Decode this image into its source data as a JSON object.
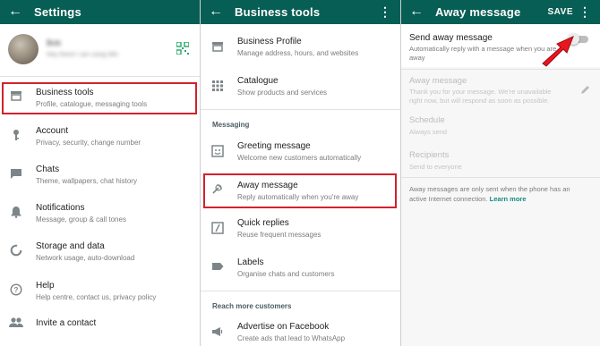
{
  "panel1": {
    "appbar": {
      "title": "Settings"
    },
    "profile": {
      "name": "Bob",
      "status": "Hey there! I am using WhatsApp."
    },
    "items": [
      {
        "title": "Business tools",
        "subtitle": "Profile, catalogue, messaging tools",
        "icon": "store-icon"
      },
      {
        "title": "Account",
        "subtitle": "Privacy, security, change number",
        "icon": "key-icon"
      },
      {
        "title": "Chats",
        "subtitle": "Theme, wallpapers, chat history",
        "icon": "chat-icon"
      },
      {
        "title": "Notifications",
        "subtitle": "Message, group & call tones",
        "icon": "bell-icon"
      },
      {
        "title": "Storage and data",
        "subtitle": "Network usage, auto-download",
        "icon": "data-usage-icon"
      },
      {
        "title": "Help",
        "subtitle": "Help centre, contact us, privacy policy",
        "icon": "help-icon"
      },
      {
        "title": "Invite a contact",
        "subtitle": "",
        "icon": "people-icon"
      }
    ]
  },
  "panel2": {
    "appbar": {
      "title": "Business tools"
    },
    "top_items": [
      {
        "title": "Business Profile",
        "subtitle": "Manage address, hours, and websites",
        "icon": "store-icon"
      },
      {
        "title": "Catalogue",
        "subtitle": "Show products and services",
        "icon": "grid-icon"
      }
    ],
    "messaging_header": "Messaging",
    "messaging_items": [
      {
        "title": "Greeting message",
        "subtitle": "Welcome new customers automatically",
        "icon": "greeting-icon"
      },
      {
        "title": "Away message",
        "subtitle": "Reply automatically when you're away",
        "icon": "away-icon"
      },
      {
        "title": "Quick replies",
        "subtitle": "Reuse frequent messages",
        "icon": "quick-reply-icon"
      },
      {
        "title": "Labels",
        "subtitle": "Organise chats and customers",
        "icon": "label-icon"
      }
    ],
    "reach_header": "Reach more customers",
    "reach_items": [
      {
        "title": "Advertise on Facebook",
        "subtitle": "Create ads that lead to WhatsApp",
        "icon": "megaphone-icon"
      }
    ]
  },
  "panel3": {
    "appbar": {
      "title": "Away message",
      "save": "SAVE"
    },
    "send_away": {
      "title": "Send away message",
      "subtitle_line1": "Automatically reply with a message when you are",
      "subtitle_line2": "away",
      "enabled": false
    },
    "away_message": {
      "title": "Away message",
      "line1": "Thank you for your message. We're unavailable",
      "line2": "right now, but will respond as soon as possible."
    },
    "schedule": {
      "title": "Schedule",
      "value": "Always send"
    },
    "recipients": {
      "title": "Recipients",
      "value": "Send to everyone"
    },
    "note": {
      "line1": "Away messages are only sent when the phone has an",
      "line2_prefix": "active Internet connection.",
      "link": "Learn more"
    }
  },
  "colors": {
    "appbar": "#075e54",
    "highlight": "#d3212c",
    "link": "#128c7e",
    "arrow": "#e8161f",
    "qr": "#25a66a"
  }
}
